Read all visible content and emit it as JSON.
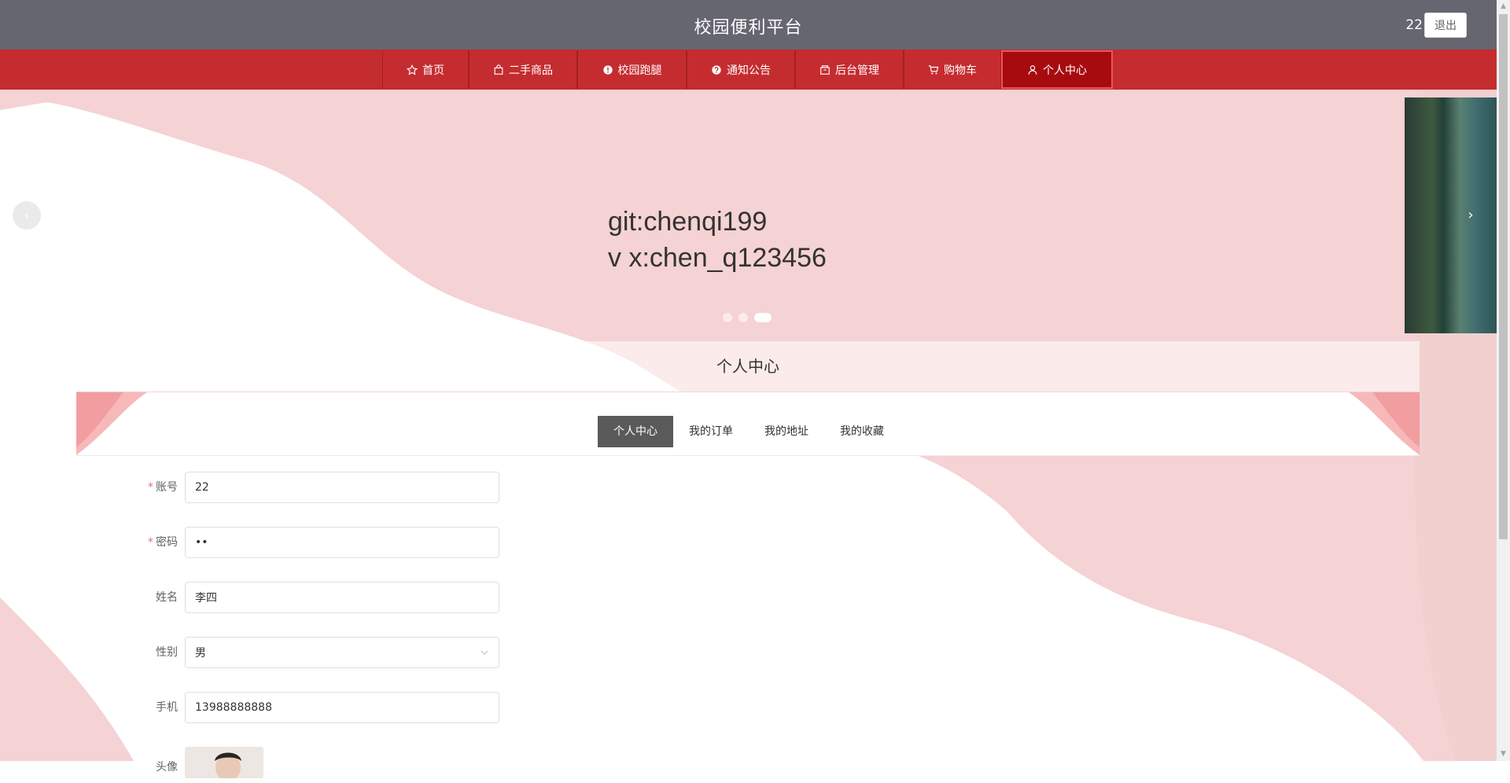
{
  "header": {
    "site_title": "校园便利平台",
    "username": "22",
    "logout_label": "退出"
  },
  "nav": {
    "items": [
      {
        "label": "首页",
        "icon": "star-icon"
      },
      {
        "label": "二手商品",
        "icon": "bag-icon"
      },
      {
        "label": "校园跑腿",
        "icon": "info-circle-icon"
      },
      {
        "label": "通知公告",
        "icon": "question-circle-icon"
      },
      {
        "label": "后台管理",
        "icon": "box-icon"
      },
      {
        "label": "购物车",
        "icon": "cart-icon"
      },
      {
        "label": "个人中心",
        "icon": "user-icon"
      }
    ],
    "active_index": 6
  },
  "banner": {
    "line1": "git:chenqi199",
    "line2": "v x:chen_q123456",
    "prev_glyph": "‹",
    "next_glyph": "›",
    "slide_count": 3,
    "active_slide": 3
  },
  "section": {
    "title": "个人中心"
  },
  "tabs": [
    {
      "label": "个人中心",
      "active": true
    },
    {
      "label": "我的订单",
      "active": false
    },
    {
      "label": "我的地址",
      "active": false
    },
    {
      "label": "我的收藏",
      "active": false
    }
  ],
  "form": {
    "account": {
      "label": "账号",
      "required": "*",
      "value": "22"
    },
    "password": {
      "label": "密码",
      "required": "*",
      "value": "••"
    },
    "name": {
      "label": "姓名",
      "value": "李四"
    },
    "gender": {
      "label": "性别",
      "value": "男"
    },
    "phone": {
      "label": "手机",
      "value": "13988888888"
    },
    "avatar": {
      "label": "头像"
    }
  },
  "colors": {
    "header_bg": "#666671",
    "nav_bg": "#c52c30",
    "nav_active_bg": "#a80b0f",
    "banner_pink": "#f4d3d3",
    "tab_active_bg": "#5a5a5a",
    "required": "#f56c6c"
  }
}
